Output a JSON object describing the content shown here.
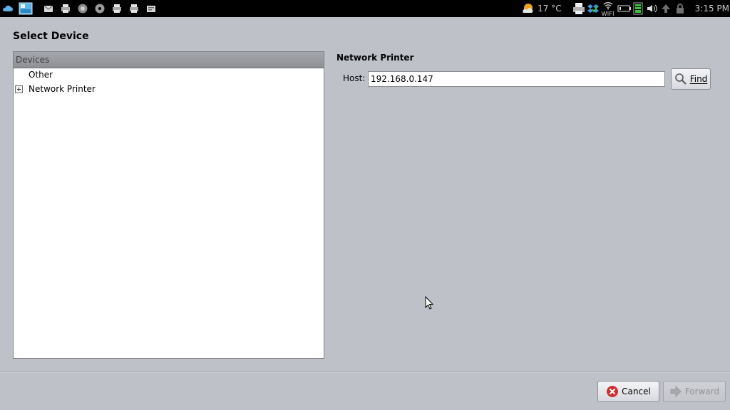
{
  "taskbar": {
    "left_icons": [
      "cloud-icon",
      "desktop-icon",
      "mail-icon",
      "printer-icon",
      "firefox-icon",
      "disc-icon",
      "printer-icon",
      "printer-icon",
      "message-icon"
    ],
    "weather": "17 °C",
    "wifi_label": "WIFI",
    "clock": "3:15 PM",
    "right_icons": [
      "printer-status-icon",
      "dropbox-icon",
      "wifi-icon",
      "battery-icon",
      "signal-icon",
      "volume-icon",
      "update-icon",
      "lock-icon"
    ]
  },
  "dialog": {
    "title": "Select Device",
    "devices_header": "Devices",
    "tree": {
      "other": "Other",
      "network_printer": "Network Printer"
    },
    "network_printer_heading": "Network Printer",
    "host_label": "Host:",
    "host_value": "192.168.0.147",
    "find_label": "Find",
    "cancel_label": "Cancel",
    "forward_label": "Forward"
  },
  "colors": {
    "background": "#bfc1c9",
    "taskbar": "#000000",
    "cancel_icon": "#d03030"
  }
}
